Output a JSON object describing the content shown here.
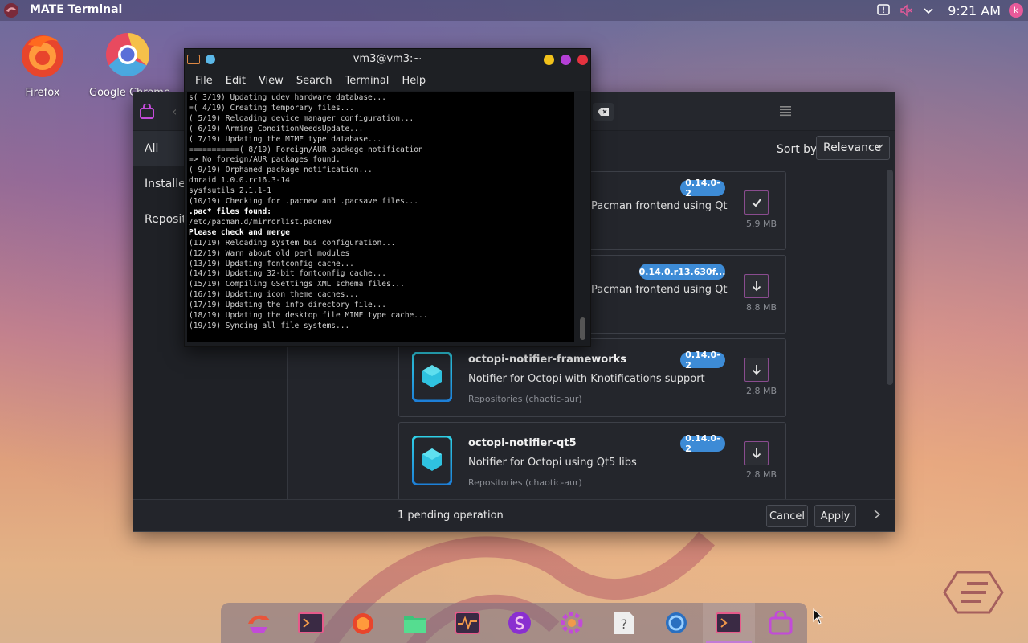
{
  "top_panel": {
    "app_title": "MATE Terminal",
    "clock": "9:21 AM",
    "user_initial": "k"
  },
  "desktop": {
    "icons": [
      {
        "label": "Firefox",
        "icon": "firefox-icon"
      },
      {
        "label": "Google Chrome",
        "icon": "chrome-icon"
      }
    ]
  },
  "octopi": {
    "sidebar": [
      {
        "label": "All",
        "active": true
      },
      {
        "label": "Installed"
      },
      {
        "label": "Reposito"
      }
    ],
    "sort_label": "Sort by",
    "sort_value": "Relevance",
    "packages": [
      {
        "name": "",
        "description": "Pacman frontend using Qt",
        "repo": "",
        "version": "0.14.0-2",
        "size": "5.9 MB",
        "action": "installed"
      },
      {
        "name": "",
        "description": "Pacman frontend using Qt",
        "repo": "",
        "version": "0.14.0.r13.630f...",
        "size": "8.8 MB",
        "action": "install"
      },
      {
        "name": "octopi-notifier-frameworks",
        "description": "Notifier for Octopi with Knotifications support",
        "repo": "Repositories (chaotic-aur)",
        "version": "0.14.0-2",
        "size": "2.8 MB",
        "action": "install"
      },
      {
        "name": "octopi-notifier-qt5",
        "description": "Notifier for Octopi using Qt5 libs",
        "repo": "Repositories (chaotic-aur)",
        "version": "0.14.0-2",
        "size": "2.8 MB",
        "action": "install"
      }
    ],
    "footer": {
      "pending": "1 pending operation",
      "cancel": "Cancel",
      "apply": "Apply"
    }
  },
  "terminal": {
    "title": "vm3@vm3:~",
    "menu": [
      "File",
      "Edit",
      "View",
      "Search",
      "Terminal",
      "Help"
    ],
    "lines": [
      "s( 3/19) Updating udev hardware database...",
      "=( 4/19) Creating temporary files...",
      "( 5/19) Reloading device manager configuration...",
      "( 6/19) Arming ConditionNeedsUpdate...",
      "( 7/19) Updating the MIME type database...",
      "===========( 8/19) Foreign/AUR package notification",
      "=> No foreign/AUR packages found.",
      "( 9/19) Orphaned package notification...",
      "dmraid 1.0.0.rc16.3-14",
      "sysfsutils 2.1.1-1",
      "(10/19) Checking for .pacnew and .pacsave files...",
      ".pac* files found:",
      "/etc/pacman.d/mirrorlist.pacnew",
      "Please check and merge",
      "(11/19) Reloading system bus configuration...",
      "(12/19) Warn about old perl modules",
      "(13/19) Updating fontconfig cache...",
      "(14/19) Updating 32-bit fontconfig cache...",
      "(15/19) Compiling GSettings XML schema files...",
      "(16/19) Updating icon theme caches...",
      "(17/19) Updating the info directory file...",
      "(18/19) Updating the desktop file MIME type cache...",
      "(19/19) Syncing all file systems..."
    ],
    "bold_lines": [
      11,
      13
    ]
  },
  "dock": {
    "items": [
      "garuda-icon",
      "terminal-icon",
      "firefox-icon",
      "files-icon",
      "system-monitor-icon",
      "garuda-settings-icon",
      "gear-app-icon",
      "help-icon",
      "browser-icon",
      "terminal-active-icon",
      "octopi-icon"
    ],
    "active_index": 9
  },
  "colors": {
    "accent": "#3d8bd6",
    "button_border": "#8a4c8f",
    "window_bg": "#23252b"
  }
}
